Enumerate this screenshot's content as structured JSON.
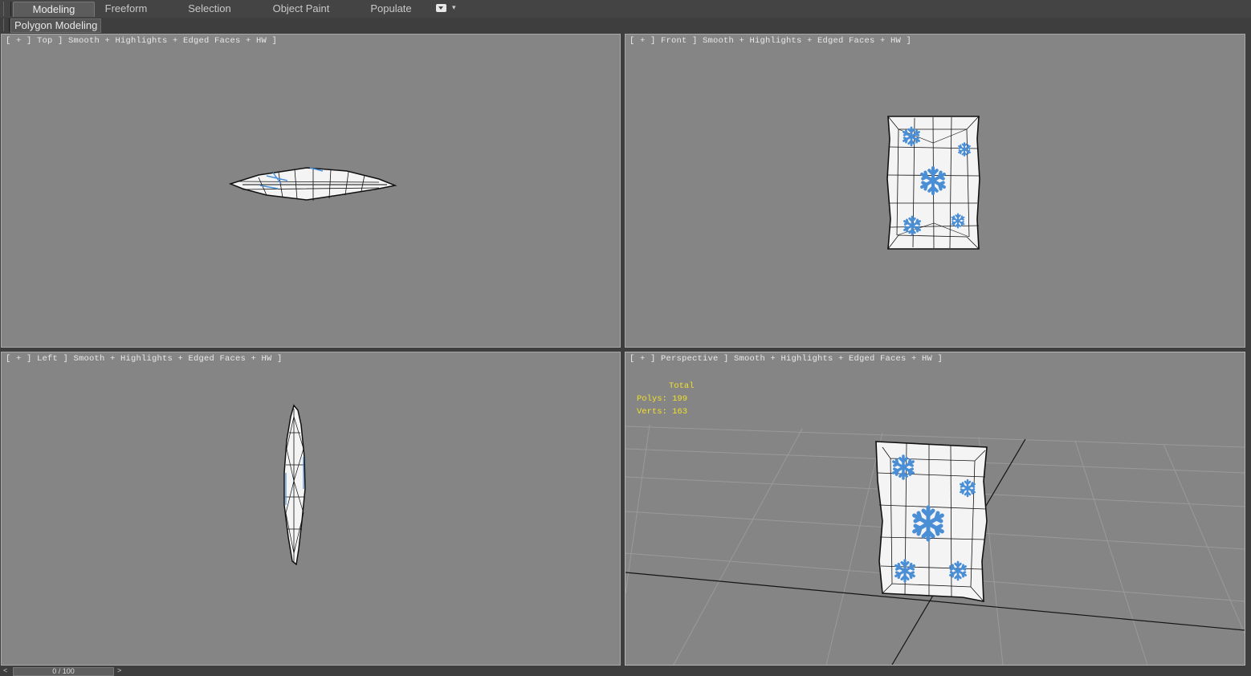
{
  "ribbon": {
    "tabs": [
      {
        "label": "Modeling",
        "active": true
      },
      {
        "label": "Freeform",
        "active": false
      },
      {
        "label": "Selection",
        "active": false
      },
      {
        "label": "Object Paint",
        "active": false
      },
      {
        "label": "Populate",
        "active": false
      }
    ],
    "sub_label": "Polygon Modeling"
  },
  "viewports": {
    "top": {
      "label": "[ + ] Top ] Smooth + Highlights + Edged Faces + HW ]"
    },
    "front": {
      "label": "[ + ] Front ] Smooth + Highlights + Edged Faces + HW ]"
    },
    "left": {
      "label": "[ + ] Left ] Smooth + Highlights + Edged Faces + HW ]"
    },
    "perspective": {
      "label": "[ + ] Perspective ] Smooth + Highlights + Edged Faces + HW ]",
      "stats": {
        "header": "Total",
        "polys_label": "Polys:",
        "polys": "199",
        "verts_label": "Verts:",
        "verts": "163"
      }
    }
  },
  "timeslider": {
    "value": "0 / 100"
  },
  "colors": {
    "viewport_bg": "#858585",
    "stats_text": "#f0e02c",
    "snowflake": "#4a8fd6",
    "ui_bg": "#3e3e3e"
  }
}
